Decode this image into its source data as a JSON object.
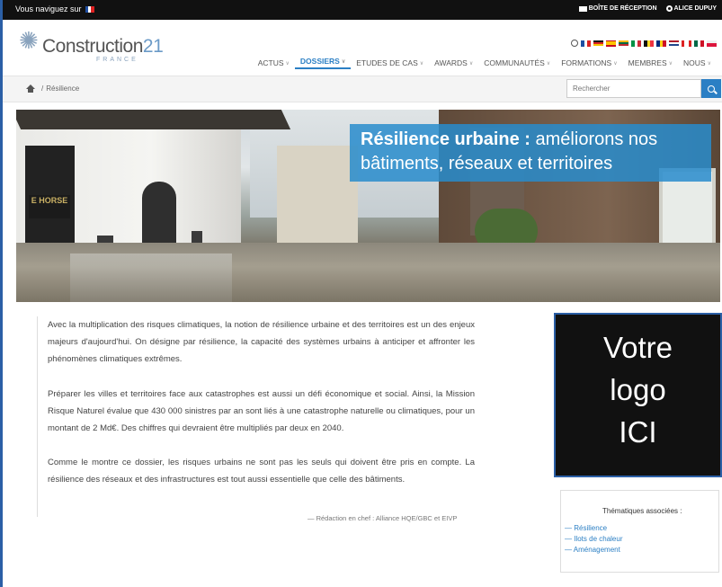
{
  "topbar": {
    "nav_msg": "Vous naviguez sur",
    "inbox": "BOÎTE DE RÉCEPTION",
    "user": "ALICE DUPUY"
  },
  "brand": {
    "name_main": "Construction",
    "name_num": "21",
    "subtitle": "FRANCE"
  },
  "menu": [
    {
      "label": "ACTUS",
      "active": false
    },
    {
      "label": "DOSSIERS",
      "active": true
    },
    {
      "label": "ETUDES DE CAS",
      "active": false
    },
    {
      "label": "AWARDS",
      "active": false
    },
    {
      "label": "COMMUNAUTÉS",
      "active": false
    },
    {
      "label": "FORMATIONS",
      "active": false
    },
    {
      "label": "MEMBRES",
      "active": false
    },
    {
      "label": "NOUS",
      "active": false
    }
  ],
  "breadcrumb": {
    "sep": "/",
    "current": "Résilience"
  },
  "search": {
    "placeholder": "Rechercher"
  },
  "hero": {
    "title_bold": "Résilience urbaine :",
    "title_rest": " améliorons nos",
    "title_line2": "bâtiments, réseaux et territoires",
    "shop_sign": "E HORSE"
  },
  "article": {
    "p1": "Avec la multiplication des risques climatiques, la notion de résilience urbaine et des territoires est un des enjeux majeurs d'aujourd'hui. On désigne par résilience, la capacité des systèmes urbains à anticiper et affronter les phénomènes climatiques extrêmes.",
    "p2": "Préparer les villes et territoires face aux catastrophes est aussi un défi économique et social. Ainsi, la Mission Risque Naturel évalue que 430 000 sinistres par an sont liés à une catastrophe naturelle ou climatiques, pour un montant de 2 Md€. Des chiffres qui devraient être multipliés par deux en 2040.",
    "p3": "Comme le montre ce dossier, les risques urbains ne sont pas les seuls qui doivent être pris en compte. La résilience des réseaux et des infrastructures est tout aussi essentielle que celle des bâtiments.",
    "signature": "— Rédaction en chef : Alliance HQE/GBC et EIVP"
  },
  "logo_box": {
    "line1": "Votre",
    "line2": "logo",
    "line3": "ICI"
  },
  "themes": {
    "title": "Thématiques associées :",
    "items": [
      "— Résilience",
      "— Ilots de chaleur",
      "— Aménagement"
    ]
  }
}
